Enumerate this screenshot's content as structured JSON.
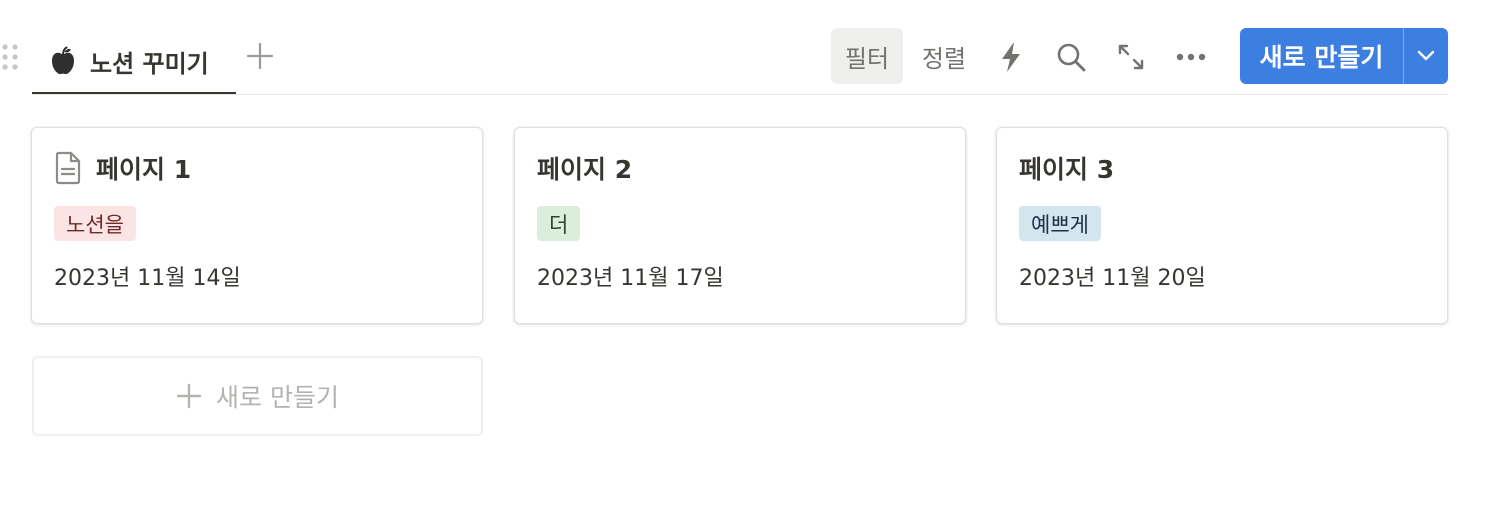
{
  "view": {
    "tab_label": "노션 꾸미기"
  },
  "toolbar": {
    "filter_label": "필터",
    "sort_label": "정렬",
    "new_label": "새로 만들기"
  },
  "cards": [
    {
      "title": "페이지 1",
      "tag": "노션을",
      "tag_bg": "#fbe4e4",
      "tag_color": "#6e2a2a",
      "date": "2023년 11월 14일",
      "has_icon": true
    },
    {
      "title": "페이지 2",
      "tag": "더",
      "tag_bg": "#dbeddb",
      "tag_color": "#2b4a2b",
      "date": "2023년 11월 17일",
      "has_icon": false
    },
    {
      "title": "페이지 3",
      "tag": "예쁘게",
      "tag_bg": "#d3e5ef",
      "tag_color": "#183347",
      "date": "2023년 11월 20일",
      "has_icon": false
    }
  ],
  "add_card_label": "새로 만들기",
  "colors": {
    "accent": "#3d7fe0"
  }
}
